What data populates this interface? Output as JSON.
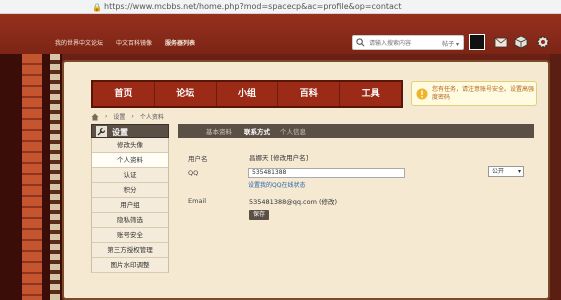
{
  "browser": {
    "url": "https://www.mcbbs.net/home.php?mod=spacecp&ac=profile&op=contact"
  },
  "topnav": {
    "links": [
      "我的世界中文论坛",
      "中文百科镜像",
      "服务器列表"
    ],
    "search_placeholder": "请输入搜索内容",
    "search_scope": "帖子"
  },
  "mainnav": {
    "tabs": [
      "首页",
      "论坛",
      "小组",
      "百科",
      "工具"
    ]
  },
  "notice": {
    "text": "您有任务，请注意账号安全。设置高强度密码"
  },
  "breadcrumb": {
    "items": [
      "设置",
      "个人资料"
    ]
  },
  "sidebar": {
    "title": "设置",
    "items": [
      "修改头像",
      "个人资料",
      "认证",
      "积分",
      "用户组",
      "隐私筛选",
      "账号安全",
      "第三方授权管理",
      "图片水印调整"
    ],
    "active_index": 1
  },
  "content_tabs": [
    "基本资料",
    "联系方式",
    "个人信息"
  ],
  "content_tabs_active": 1,
  "form": {
    "username_label": "用户名",
    "username_value": "昌娜天 [修改用户名]",
    "qq_label": "QQ",
    "qq_value": "535481388",
    "qq_bind_link": "设置我的QQ在线状态",
    "privacy_value": "公开",
    "email_label": "Email",
    "email_value": "535481388@qq.com (修改)",
    "save_label": "保存"
  },
  "colors": {
    "nav_red": "#9b2a16",
    "frame_bg": "#f5e9d2",
    "panel_dark": "#5b5046",
    "link_blue": "#2a66a8"
  }
}
